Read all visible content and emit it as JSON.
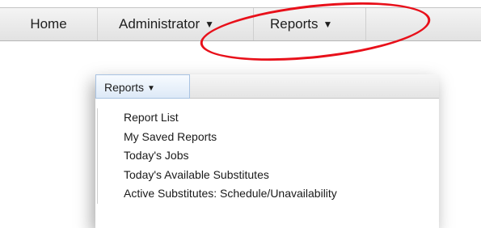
{
  "navbar": {
    "items": [
      {
        "label": "Home"
      },
      {
        "label": "Administrator",
        "caret": "▼"
      },
      {
        "label": "Reports",
        "caret": "▼"
      }
    ]
  },
  "dropdown": {
    "header_label": "Reports",
    "header_caret": "▼",
    "items": [
      "Report List",
      "My Saved Reports",
      "Today's Jobs",
      "Today's Available Substitutes",
      "Active Substitutes: Schedule/Unavailability"
    ]
  },
  "annotation": {
    "color": "#e8101a"
  }
}
